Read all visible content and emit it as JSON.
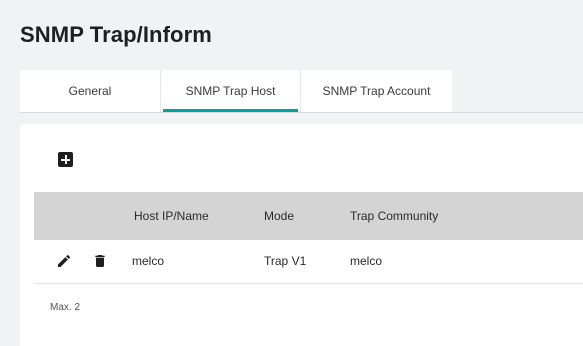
{
  "page": {
    "title": "SNMP Trap/Inform"
  },
  "tabs": [
    {
      "label": "General",
      "active": false
    },
    {
      "label": "SNMP Trap Host",
      "active": true
    },
    {
      "label": "SNMP Trap Account",
      "active": false
    }
  ],
  "colors": {
    "accent": "#00a5a0",
    "header_bg": "#d4d4d4",
    "page_bg": "#f1f2f4"
  },
  "toolbar": {
    "add_icon": "plus-square-icon"
  },
  "table": {
    "columns": [
      "Host IP/Name",
      "Mode",
      "Trap Community"
    ],
    "rows": [
      {
        "host": "melco",
        "mode": "Trap V1",
        "community": "melco"
      }
    ],
    "row_actions": [
      "pencil-icon",
      "trash-icon"
    ]
  },
  "footer": {
    "max_note": "Max. 2"
  }
}
